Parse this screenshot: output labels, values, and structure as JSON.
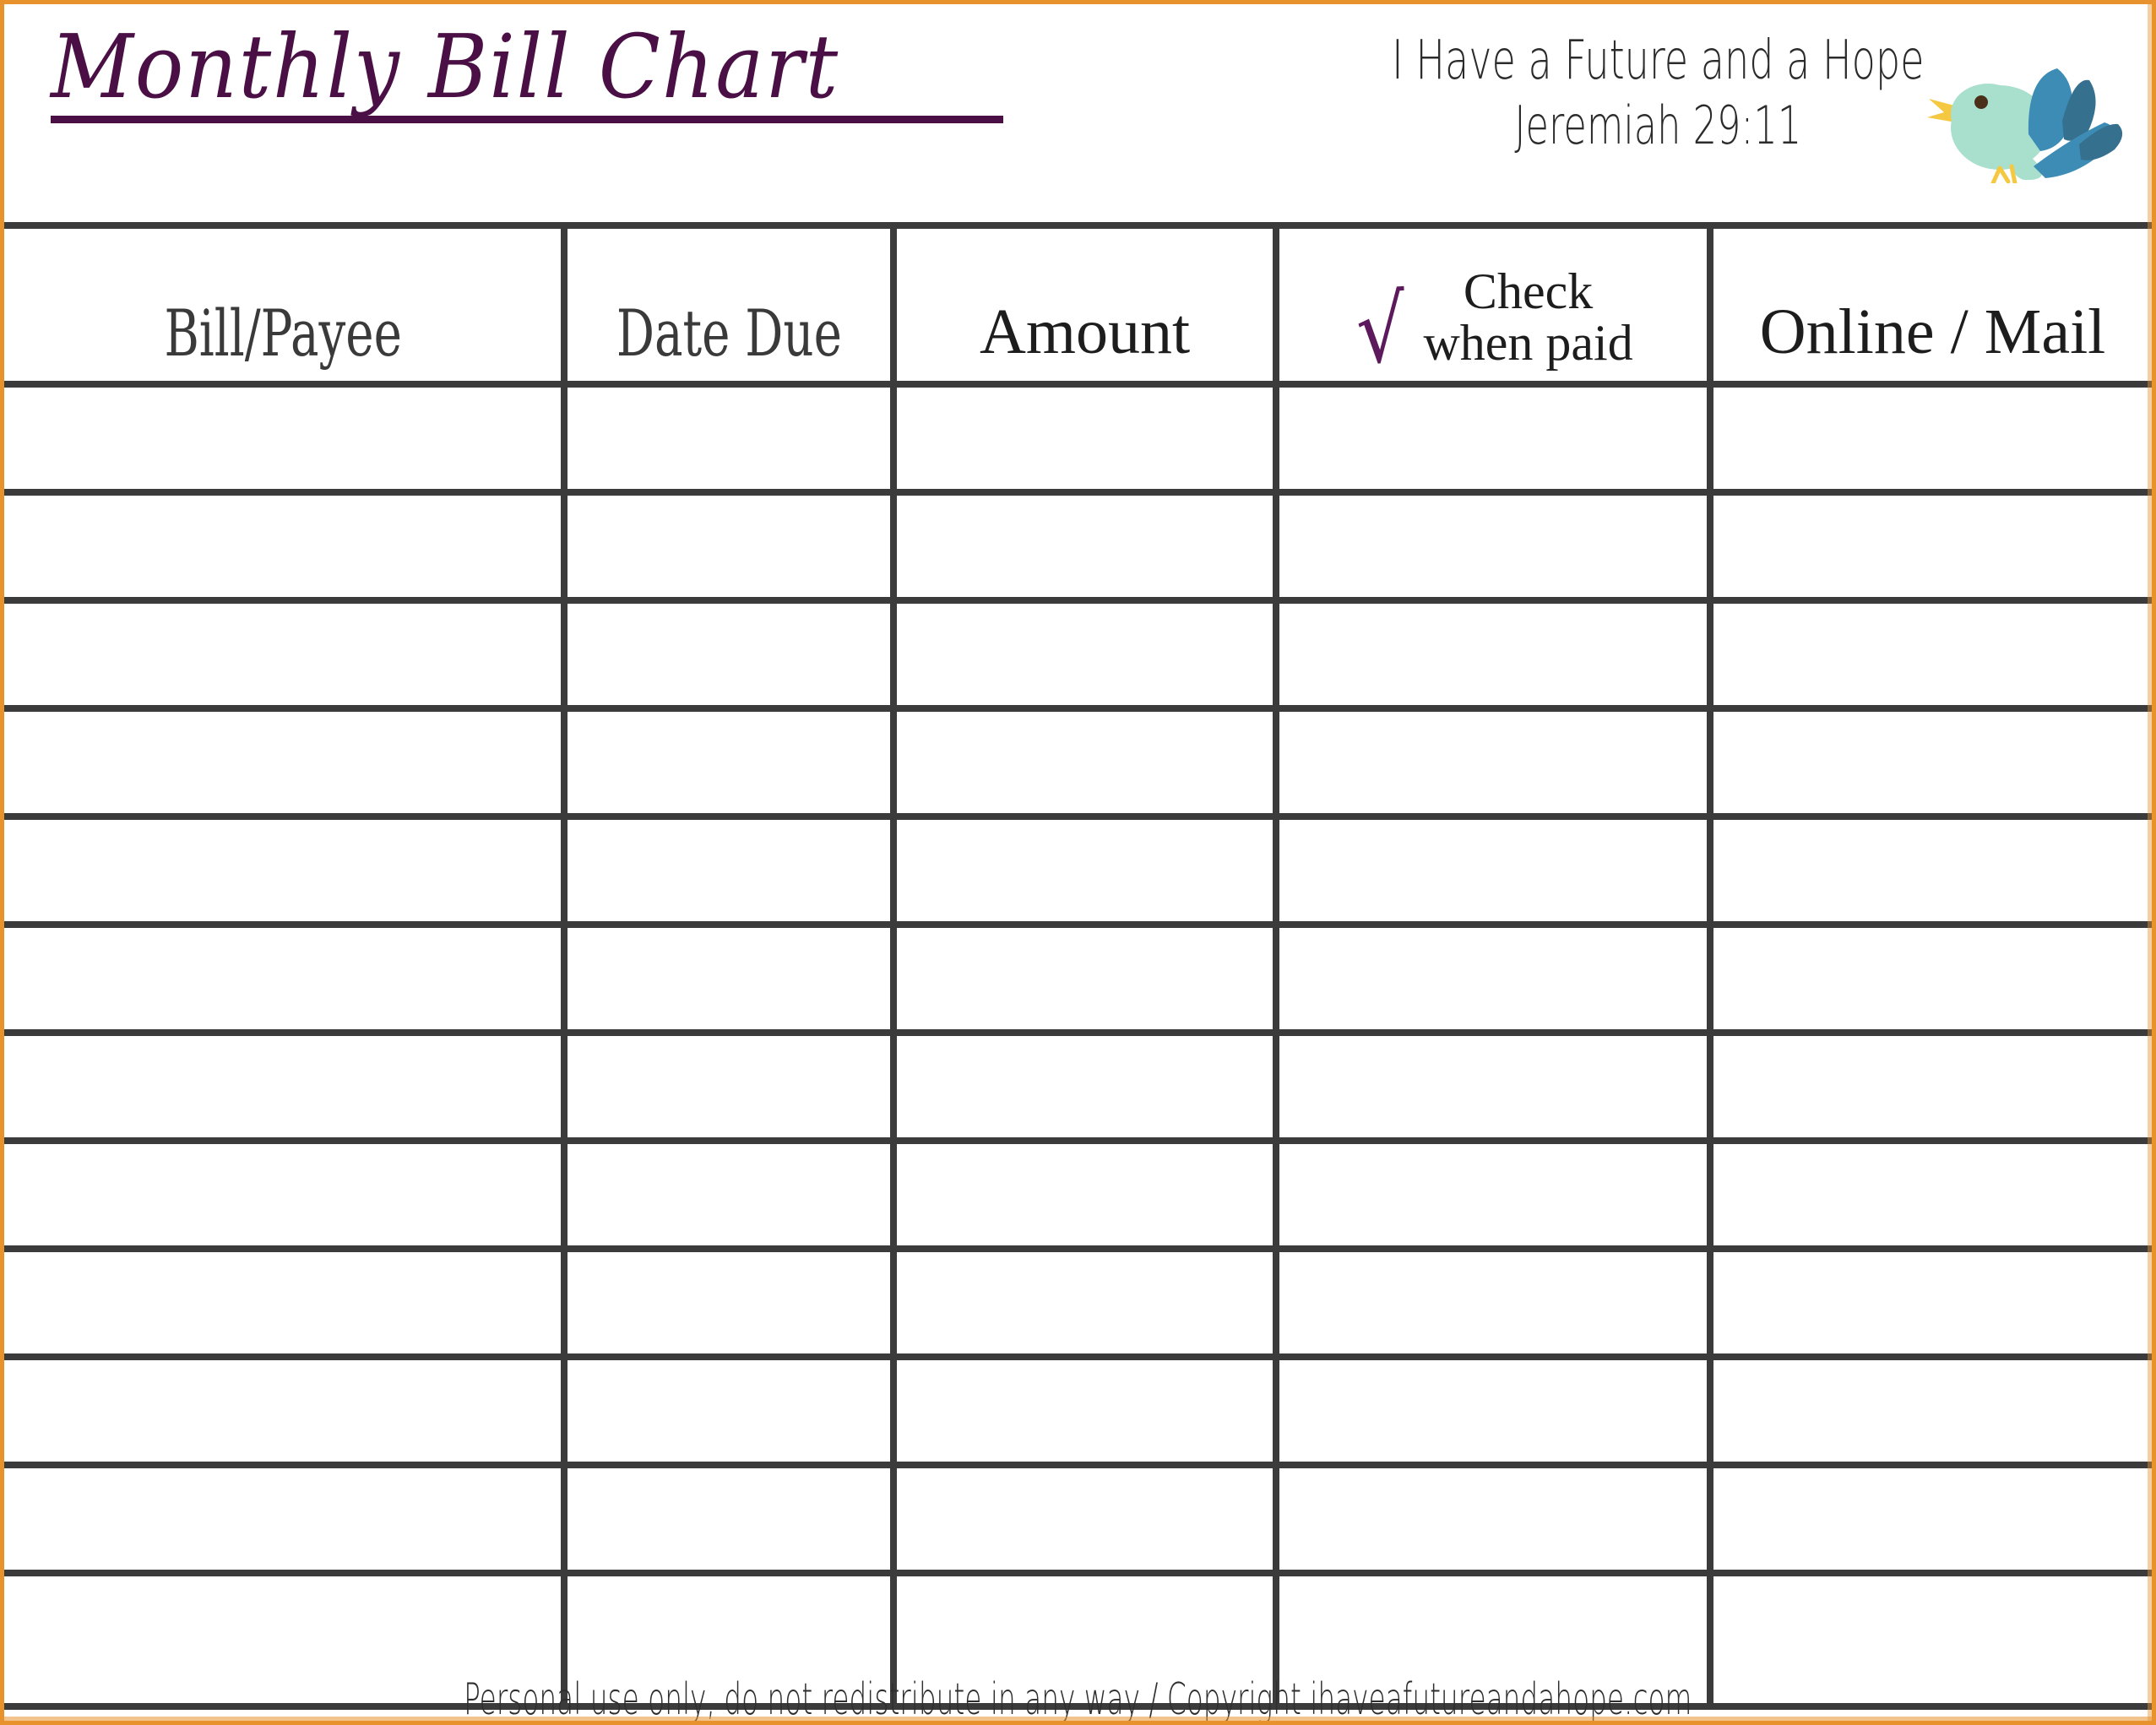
{
  "page": {
    "border_color": "#e8922e",
    "background": "#ffffff"
  },
  "masthead": {
    "title": "Monthly Bill Chart",
    "title_color": "#4a1046",
    "tagline_line1": "I Have a Future and a Hope",
    "tagline_line2": "Jeremiah 29:11",
    "bird": {
      "body_color": "#a9dfcd",
      "wing_color": "#3d8cb5",
      "wing_shadow_color": "#35708f",
      "beak_color": "#f5c842",
      "eye_color": "#4a3018"
    }
  },
  "table": {
    "border_color": "#3b3b3b",
    "columns": [
      {
        "key": "bill_payee",
        "label": "Bill/Payee",
        "style": "condensed"
      },
      {
        "key": "date_due",
        "label": "Date Due",
        "style": "condensed"
      },
      {
        "key": "amount",
        "label": "Amount",
        "style": "serif"
      },
      {
        "key": "check_when_paid",
        "label_line1": "Check",
        "label_line2": "when paid",
        "check_glyph": "√",
        "check_color": "#5c1a5c",
        "style": "check"
      },
      {
        "key": "online_mail",
        "label": "Online / Mail",
        "style": "serif"
      }
    ],
    "row_count": 12,
    "rows": [
      {
        "bill_payee": "",
        "date_due": "",
        "amount": "",
        "check_when_paid": "",
        "online_mail": ""
      },
      {
        "bill_payee": "",
        "date_due": "",
        "amount": "",
        "check_when_paid": "",
        "online_mail": ""
      },
      {
        "bill_payee": "",
        "date_due": "",
        "amount": "",
        "check_when_paid": "",
        "online_mail": ""
      },
      {
        "bill_payee": "",
        "date_due": "",
        "amount": "",
        "check_when_paid": "",
        "online_mail": ""
      },
      {
        "bill_payee": "",
        "date_due": "",
        "amount": "",
        "check_when_paid": "",
        "online_mail": ""
      },
      {
        "bill_payee": "",
        "date_due": "",
        "amount": "",
        "check_when_paid": "",
        "online_mail": ""
      },
      {
        "bill_payee": "",
        "date_due": "",
        "amount": "",
        "check_when_paid": "",
        "online_mail": ""
      },
      {
        "bill_payee": "",
        "date_due": "",
        "amount": "",
        "check_when_paid": "",
        "online_mail": ""
      },
      {
        "bill_payee": "",
        "date_due": "",
        "amount": "",
        "check_when_paid": "",
        "online_mail": ""
      },
      {
        "bill_payee": "",
        "date_due": "",
        "amount": "",
        "check_when_paid": "",
        "online_mail": ""
      },
      {
        "bill_payee": "",
        "date_due": "",
        "amount": "",
        "check_when_paid": "",
        "online_mail": ""
      },
      {
        "bill_payee": "",
        "date_due": "",
        "amount": "",
        "check_when_paid": "",
        "online_mail": ""
      }
    ]
  },
  "footer": {
    "text": "Personal use only, do not redistribute in any way / Copyright ihaveafutureandahope.com"
  }
}
